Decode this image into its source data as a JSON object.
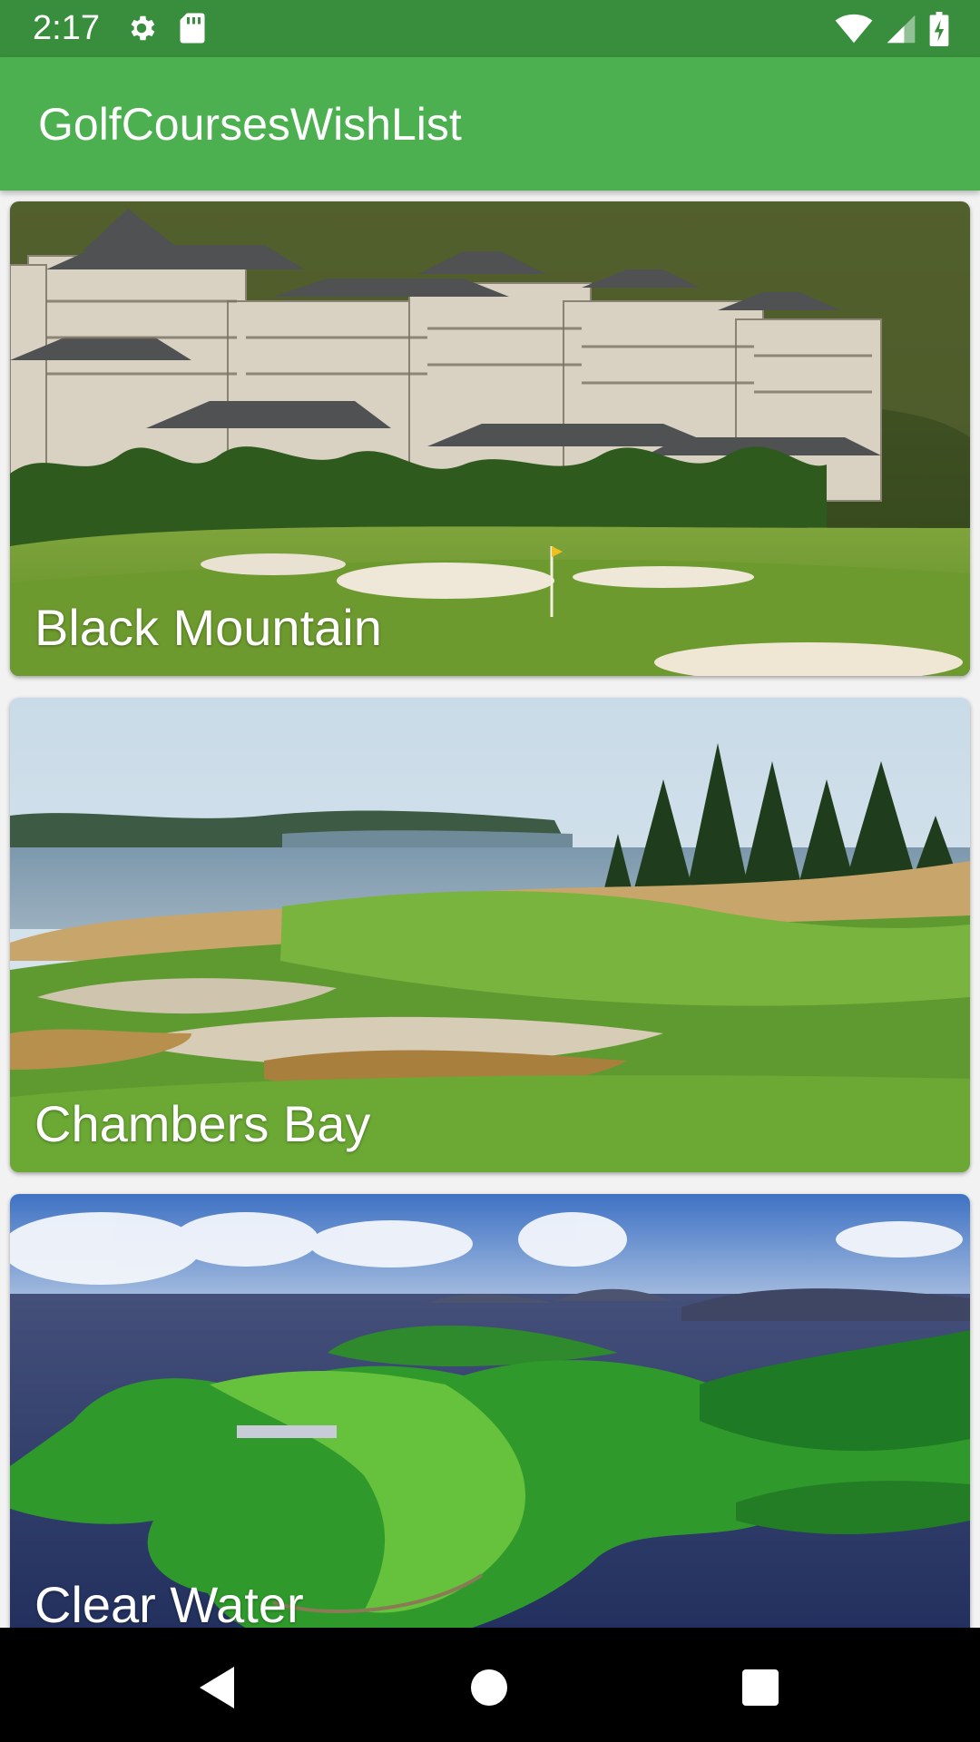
{
  "status_bar": {
    "time": "2:17",
    "icons": [
      "settings-icon",
      "sd-card-icon",
      "wifi-icon",
      "cell-signal-icon",
      "battery-charging-icon"
    ]
  },
  "app_bar": {
    "title": "GolfCoursesWishList"
  },
  "courses": [
    {
      "name": "Black Mountain",
      "image": "resort-hotel-golf-green-photo"
    },
    {
      "name": "Chambers Bay",
      "image": "links-course-bay-photo"
    },
    {
      "name": "Clear Water",
      "image": "island-course-aerial-photo"
    }
  ],
  "nav_bar": {
    "icons": [
      "back-icon",
      "home-icon",
      "recents-icon"
    ]
  },
  "colors": {
    "status_bar": "#388E3C",
    "app_bar": "#4CAF50",
    "nav_bar": "#000000",
    "text_on_primary": "#FFFFFF"
  }
}
